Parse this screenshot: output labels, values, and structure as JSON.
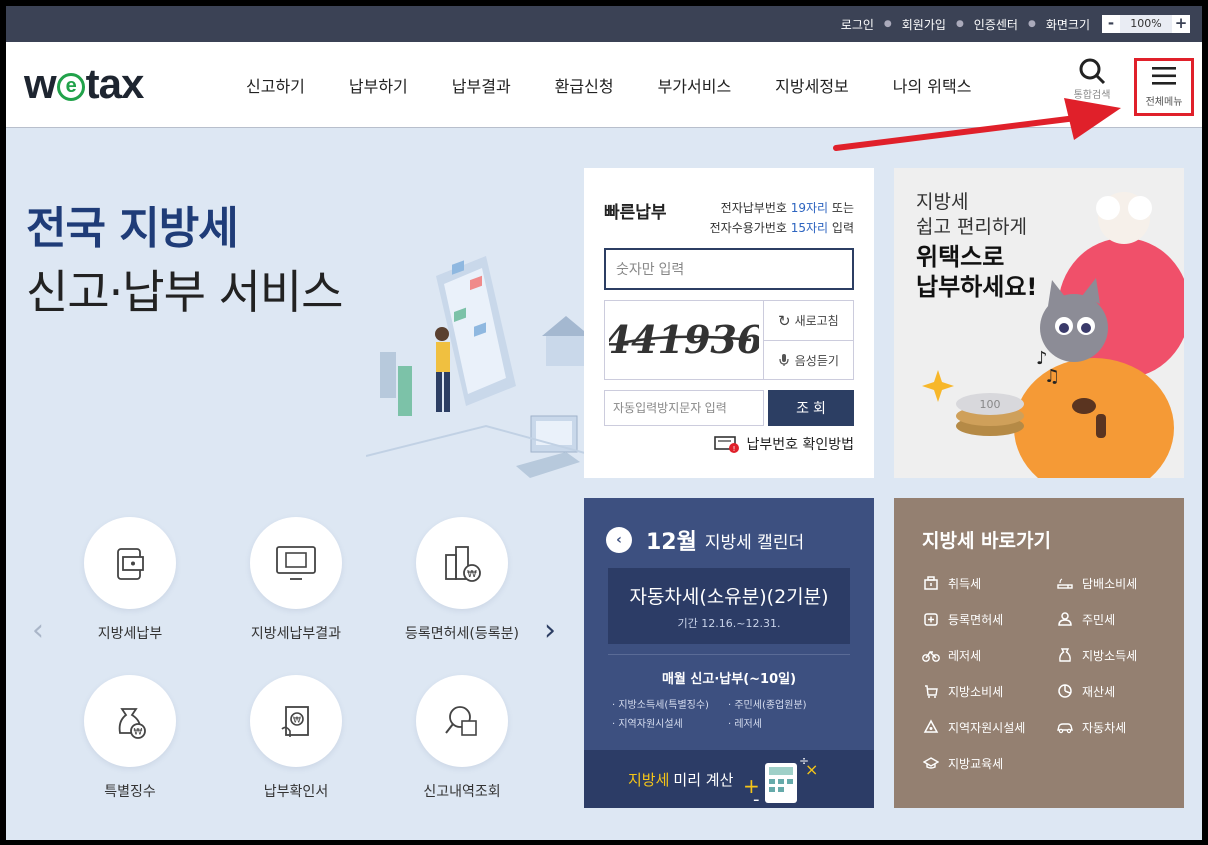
{
  "topbar": {
    "links": [
      "로그인",
      "회원가입",
      "인증센터",
      "화면크기"
    ],
    "zoom": "100%",
    "zoom_minus": "-",
    "zoom_plus": "+"
  },
  "header": {
    "logo_pre": "w",
    "logo_e": "e",
    "logo_post": "tax",
    "nav": [
      "신고하기",
      "납부하기",
      "납부결과",
      "환급신청",
      "부가서비스",
      "지방세정보",
      "나의 위택스"
    ],
    "search_label": "통합검색",
    "menu_label": "전체메뉴"
  },
  "hero": {
    "line1": "전국 지방세",
    "line2": "신고·납부 서비스"
  },
  "quick_menu": {
    "items": [
      "지방세납부",
      "지방세납부결과",
      "등록면허세(등록분)",
      "특별징수",
      "납부확인서",
      "신고내역조회"
    ]
  },
  "payment": {
    "title": "빠른납부",
    "desc1_pre": "전자납부번호 ",
    "desc1_num": "19자리",
    "desc1_post": " 또는",
    "desc2_pre": "전자수용가번호 ",
    "desc2_num": "15자리",
    "desc2_post": " 입력",
    "number_placeholder": "숫자만 입력",
    "captcha_text": "441936",
    "refresh_label": "새로고침",
    "audio_label": "음성듣기",
    "captcha_placeholder": "자동입력방지문자 입력",
    "submit_label": "조 회",
    "help_label": "납부번호 확인방법"
  },
  "banner": {
    "line1": "지방세",
    "line2": "쉽고 편리하게",
    "line3": "위택스로",
    "line4": "납부하세요!",
    "coin_text": "100"
  },
  "calendar": {
    "month": "12월",
    "title": "지방세 캘린더",
    "tax_name": "자동차세(소유분)(2기분)",
    "period": "기간 12.16.~12.31.",
    "monthly_title": "매월 신고·납부(~10일)",
    "monthly_items": [
      "· 지방소득세(특별징수)",
      "· 주민세(종업원분)",
      "· 지역자원시설세",
      "· 레저세"
    ],
    "calc_highlight": "지방세",
    "calc_rest": "미리 계산"
  },
  "shortcuts": {
    "title": "지방세 바로가기",
    "items": [
      "취득세",
      "담배소비세",
      "등록면허세",
      "주민세",
      "레저세",
      "지방소득세",
      "지방소비세",
      "재산세",
      "지역자원시설세",
      "자동차세",
      "지방교육세"
    ]
  },
  "colors": {
    "topbar": "#3b4255",
    "navy": "#2c3e63",
    "highlight_red": "#e0202a",
    "calendar_bg": "#3d5080",
    "shortcut_bg": "#948071",
    "page_bg": "#dde7f3"
  }
}
